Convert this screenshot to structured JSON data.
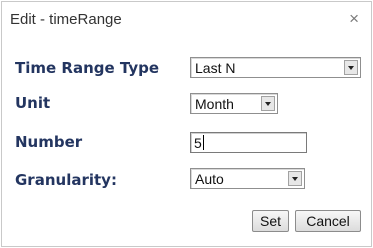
{
  "dialog": {
    "title": "Edit - timeRange",
    "close_glyph": "×"
  },
  "fields": {
    "time_range_type": {
      "label": "Time Range Type",
      "value": "Last N"
    },
    "unit": {
      "label": "Unit",
      "value": "Month"
    },
    "number": {
      "label": "Number",
      "value": "5"
    },
    "granularity": {
      "label": "Granularity:",
      "value": "Auto"
    }
  },
  "buttons": {
    "set": "Set",
    "cancel": "Cancel"
  },
  "icons": {
    "close": "close-icon",
    "dropdown": "chevron-down-icon"
  }
}
